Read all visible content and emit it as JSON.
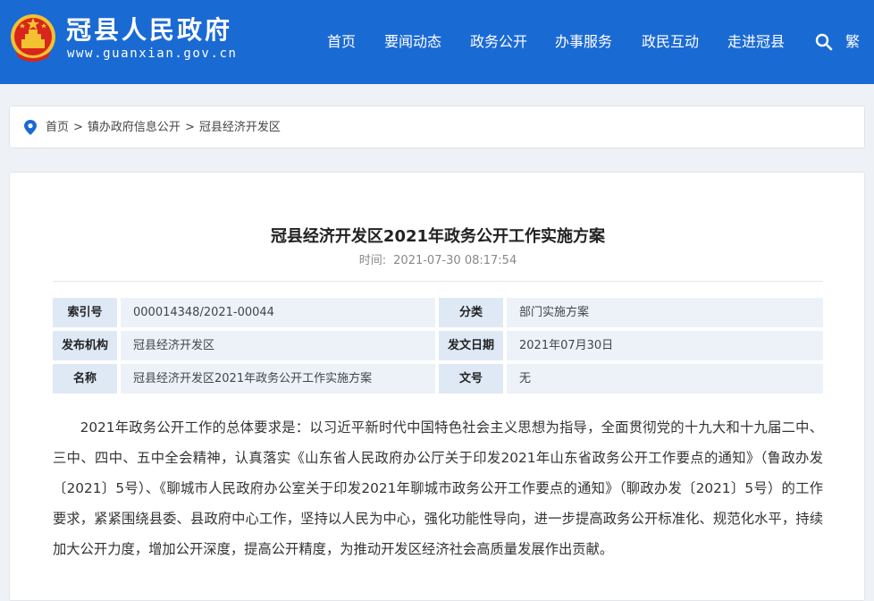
{
  "header": {
    "site_title": "冠县人民政府",
    "site_url": "www.guanxian.gov.cn",
    "nav": [
      "首页",
      "要闻动态",
      "政务公开",
      "办事服务",
      "政民互动",
      "走进冠县"
    ],
    "lang_toggle": "繁",
    "bg_color": "#1a6ad4"
  },
  "breadcrumb": {
    "items": [
      "首页",
      "镇办政府信息公开",
      "冠县经济开发区"
    ],
    "separator": ">"
  },
  "article": {
    "title": "冠县经济开发区2021年政务公开工作实施方案",
    "time_label": "时间:",
    "time_value": "2021-07-30 08:17:54",
    "meta": [
      [
        {
          "k": "索引号",
          "v": "000014348/2021-00044"
        },
        {
          "k": "分类",
          "v": "部门实施方案"
        }
      ],
      [
        {
          "k": "发布机构",
          "v": "冠县经济开发区"
        },
        {
          "k": "发文日期",
          "v": "2021年07月30日"
        }
      ],
      [
        {
          "k": "名称",
          "v": "冠县经济开发区2021年政务公开工作实施方案"
        },
        {
          "k": "文号",
          "v": "无"
        }
      ]
    ],
    "body": "2021年政务公开工作的总体要求是：以习近平新时代中国特色社会主义思想为指导，全面贯彻党的十九大和十九届二中、三中、四中、五中全会精神，认真落实《山东省人民政府办公厅关于印发2021年山东省政务公开工作要点的通知》（鲁政办发〔2021〕5号）、《聊城市人民政府办公室关于印发2021年聊城市政务公开工作要点的通知》（聊政办发〔2021〕5号）的工作要求，紧紧围绕县委、县政府中心工作，坚持以人民为中心，强化功能性导向，进一步提高政务公开标准化、规范化水平，持续加大公开力度，增加公开深度，提高公开精度，为推动开发区经济社会高质量发展作出贡献。"
  }
}
